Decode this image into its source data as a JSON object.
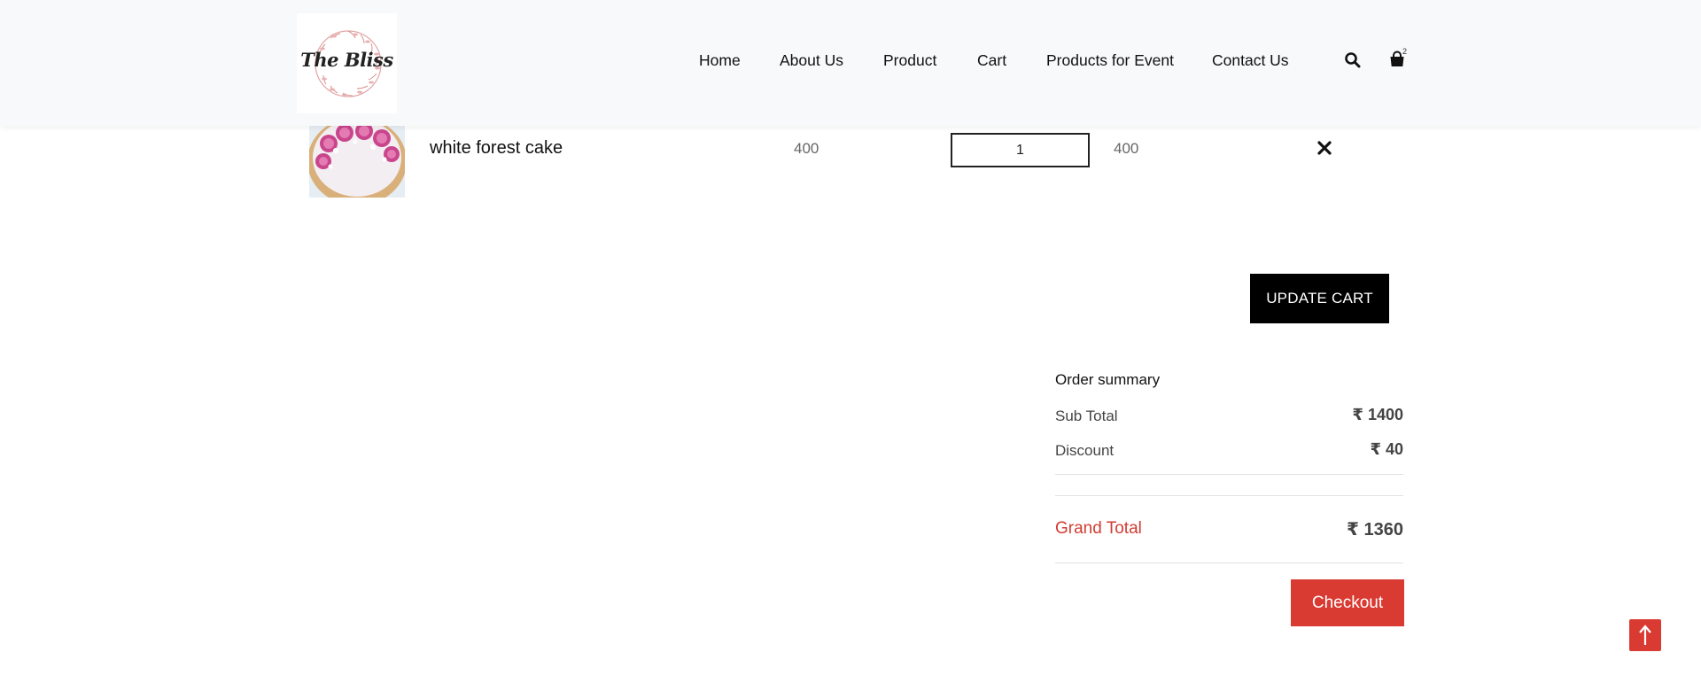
{
  "header": {
    "logo_text": "The Bliss",
    "nav": [
      {
        "label": "Home"
      },
      {
        "label": "About Us"
      },
      {
        "label": "Product"
      },
      {
        "label": "Cart"
      },
      {
        "label": "Products for Event"
      },
      {
        "label": "Contact Us"
      }
    ],
    "search_icon": "search-icon",
    "cart_icon": "shopping-bag-icon",
    "cart_count": "2"
  },
  "cart": {
    "items": [
      {
        "name": "white forest cake",
        "price": "400",
        "quantity": "1",
        "total": "400",
        "remove_icon": "close-icon"
      }
    ],
    "update_label": "UPDATE CART"
  },
  "summary": {
    "title": "Order summary",
    "subtotal_label": "Sub Total",
    "subtotal_value": "₹ 1400",
    "discount_label": "Discount",
    "discount_value": "₹ 40",
    "grand_label": "Grand Total",
    "grand_value": "₹ 1360",
    "checkout_label": "Checkout"
  },
  "scroll_top_icon": "arrow-up-icon",
  "colors": {
    "accent": "#d93a31",
    "header_bg": "#f8f9fa",
    "button_dark": "#000000"
  }
}
